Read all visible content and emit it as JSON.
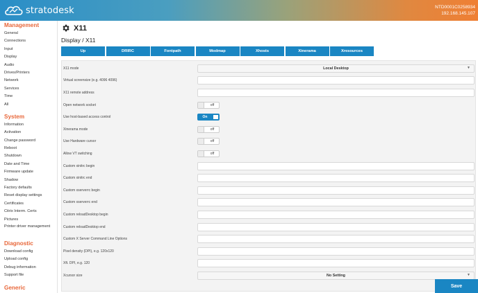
{
  "header": {
    "brand": "stratodesk",
    "device_id": "NTD0001C0258934",
    "ip": "192.168.145.107"
  },
  "sidebar": {
    "sections": [
      {
        "title": "Management",
        "items": [
          "General",
          "Connections",
          "Input",
          "Display",
          "Audio",
          "Drives/Printers",
          "Network",
          "Services",
          "Time",
          "All"
        ]
      },
      {
        "title": "System",
        "items": [
          "Information",
          "Activation",
          "Change password",
          "Reboot",
          "Shutdown",
          "Date and Time",
          "Firmware update",
          "Shadow",
          "Factory defaults",
          "Reset display settings",
          "Certificates",
          "Citrix Interm. Certs",
          "Pictures",
          "Printer driver management"
        ]
      },
      {
        "title": "Diagnostic",
        "items": [
          "Download config",
          "Upload config",
          "Debug information",
          "Support file"
        ]
      },
      {
        "title": "Generic",
        "items": []
      }
    ]
  },
  "page": {
    "title": "X11",
    "breadcrumb": "Display / X11",
    "icon": "gear-icon"
  },
  "tabs": [
    "Up",
    "DRIRC",
    "Fontpath",
    "Modmap",
    "Xhosts",
    "Xinerama",
    "Xresources"
  ],
  "form": {
    "rows": [
      {
        "label": "X11 mode",
        "type": "select",
        "value": "Local Desktop"
      },
      {
        "label": "Virtual screensize (e.g. 4096 4096)",
        "type": "text",
        "value": ""
      },
      {
        "label": "X11 remote address",
        "type": "text",
        "value": ""
      },
      {
        "label": "Open network socket",
        "type": "toggle",
        "value": "off"
      },
      {
        "label": "Use host-based access control",
        "type": "toggle",
        "value": "On"
      },
      {
        "label": "Xinerama mode",
        "type": "toggle",
        "value": "off"
      },
      {
        "label": "Use Hardware cursor",
        "type": "toggle",
        "value": "off"
      },
      {
        "label": "Allow VT switching",
        "type": "toggle",
        "value": "off"
      },
      {
        "label": "Custom xinitrc begin",
        "type": "text",
        "value": ""
      },
      {
        "label": "Custom xinitrc end",
        "type": "text",
        "value": ""
      },
      {
        "label": "Custom xserverrc begin",
        "type": "text",
        "value": ""
      },
      {
        "label": "Custom xserverrc end",
        "type": "text",
        "value": ""
      },
      {
        "label": "Custom reloadDesktop begin",
        "type": "text",
        "value": ""
      },
      {
        "label": "Custom reloadDesktop end",
        "type": "text",
        "value": ""
      },
      {
        "label": "Custom X Server Command Line Options",
        "type": "text",
        "value": ""
      },
      {
        "label": "Pixel density (DPI), e.g. 120x120",
        "type": "text",
        "value": ""
      },
      {
        "label": "Xft. DPI, e.g. 120",
        "type": "text",
        "value": ""
      },
      {
        "label": "Xcursor size",
        "type": "select",
        "value": "No Setting"
      }
    ]
  },
  "actions": {
    "save_label": "Save"
  },
  "colors": {
    "accent": "#1a86c3",
    "section_title": "#e8673a"
  }
}
